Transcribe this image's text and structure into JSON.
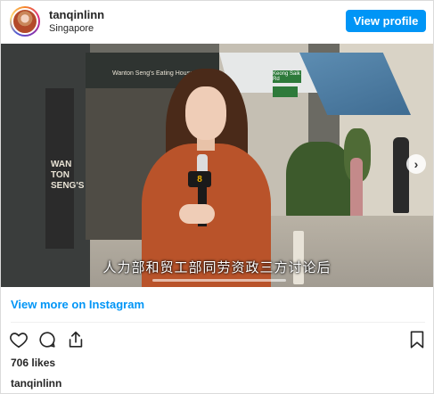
{
  "header": {
    "username": "tanqinlinn",
    "location": "Singapore",
    "view_profile_label": "View profile"
  },
  "media": {
    "subtitle": "人力部和贸工部同劳资政三方讨论后",
    "shop_sign": "WAN TON SENG'S",
    "store_sign": "Wanton Seng's Eating House",
    "street_sign": "Keong Saik Rd",
    "mic_logo": "8",
    "next_icon": "chevron-right-icon"
  },
  "view_more_label": "View more on Instagram",
  "actions": {
    "like_icon": "heart-icon",
    "comment_icon": "comment-icon",
    "share_icon": "share-icon",
    "save_icon": "bookmark-icon"
  },
  "likes_text": "706 likes",
  "caption_username": "tanqinlinn",
  "colors": {
    "accent": "#0095f6",
    "text": "#262626"
  }
}
